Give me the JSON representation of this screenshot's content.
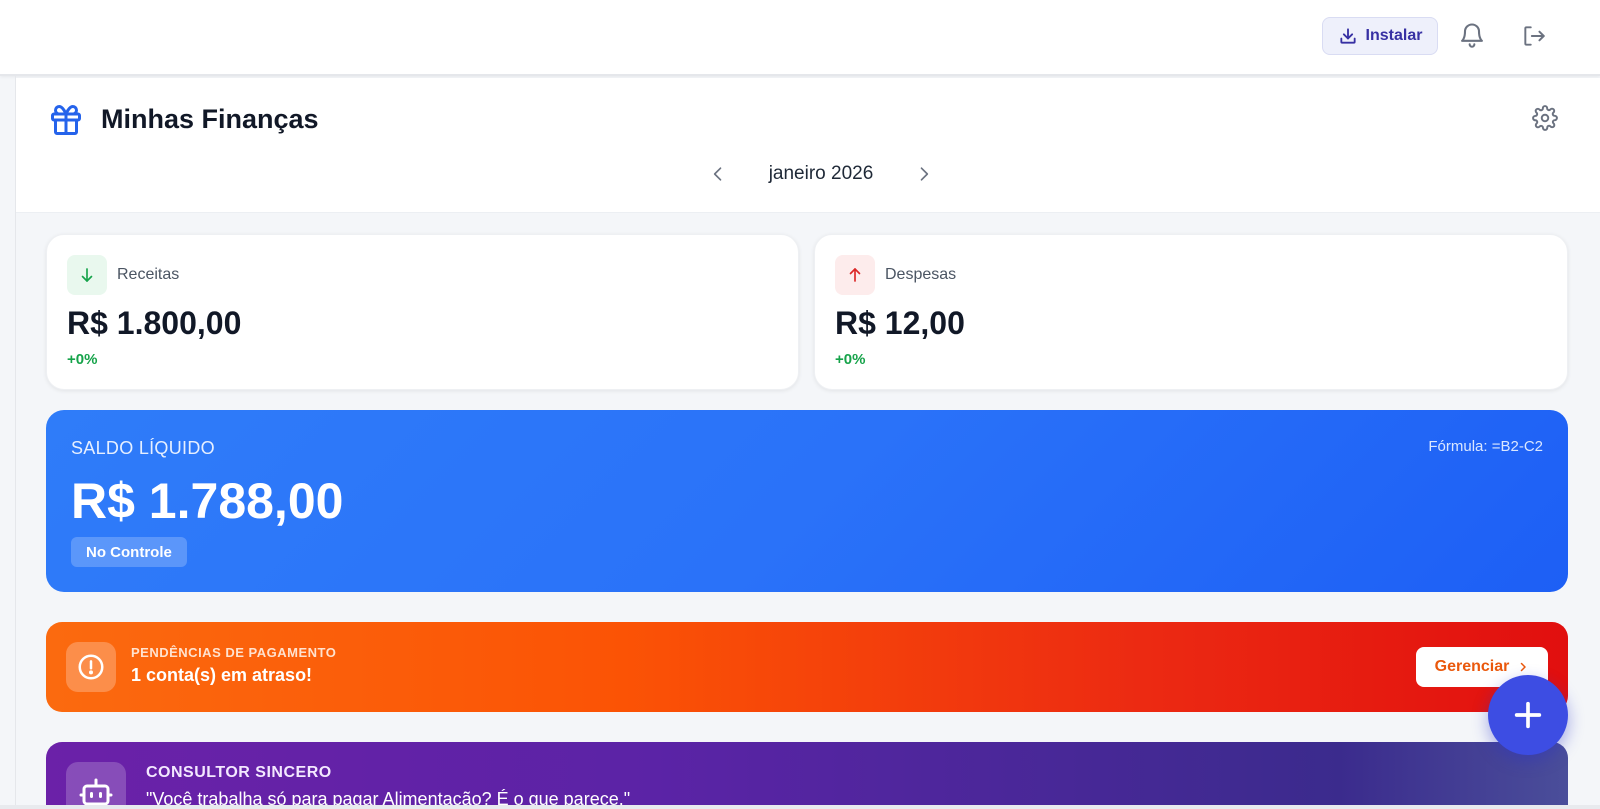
{
  "topbar": {
    "install_label": "Instalar",
    "icons": [
      "download-icon",
      "bell-icon",
      "logout-icon"
    ]
  },
  "header": {
    "title": "Minhas Finanças",
    "icon": "gift-icon",
    "month": "janeiro 2026"
  },
  "cards": {
    "income": {
      "label": "Receitas",
      "value": "R$ 1.800,00",
      "change": "+0%",
      "icon": "arrow-down-icon"
    },
    "expense": {
      "label": "Despesas",
      "value": "R$ 12,00",
      "change": "+0%",
      "icon": "arrow-up-icon"
    }
  },
  "balance": {
    "label": "SALDO LÍQUIDO",
    "formula": "Fórmula: =B2-C2",
    "value": "R$ 1.788,00",
    "badge": "No Controle"
  },
  "pending": {
    "title": "PENDÊNCIAS DE PAGAMENTO",
    "text": "1 conta(s) em atraso!",
    "button": "Gerenciar"
  },
  "advisor": {
    "title": "CONSULTOR SINCERO",
    "quote": "\"Você trabalha só para pagar Alimentação? É o que parece.\""
  },
  "colors": {
    "primary": "#2f7cf9",
    "income": "#16a34a",
    "expense": "#dc2626",
    "warning": "#fb5305",
    "advisor": "#5b23a6",
    "fab": "#3d4de3"
  }
}
